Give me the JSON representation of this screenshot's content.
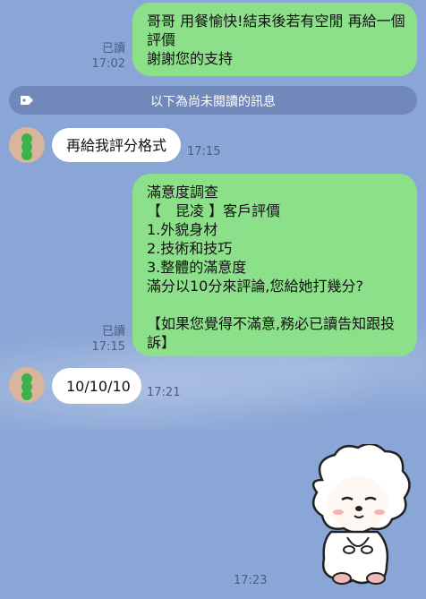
{
  "messages": {
    "m1": {
      "read_label": "已讀",
      "time": "17:02",
      "lines": [
        "哥哥 用餐愉快!結束後若有空閒 再給一個",
        "評價",
        "謝謝您的支持"
      ]
    },
    "unread_divider": "以下為尚未閱讀的訊息",
    "m2": {
      "text": "再給我評分格式",
      "time": "17:15"
    },
    "m3": {
      "read_label": "已讀",
      "time": "17:15",
      "lines": [
        "滿意度調查",
        "【　昆凌 】客戶評價",
        "1.外貌身材",
        "2.技術和技巧",
        "3.整體的滿意度",
        "滿分以10分來評論,您給她打幾分?",
        "",
        "【如果您覺得不滿意,務必已讀告知跟投",
        "訴】"
      ]
    },
    "m4": {
      "text": "10/10/10",
      "time": "17:21"
    },
    "m5": {
      "time": "17:23"
    }
  },
  "icons": {
    "tag": "tag-icon",
    "avatar": "dango-avatar-icon",
    "sticker": "sheep-sticker"
  },
  "colors": {
    "background": "#8aa6d6",
    "outgoing": "#8de08a",
    "incoming": "#ffffff"
  }
}
